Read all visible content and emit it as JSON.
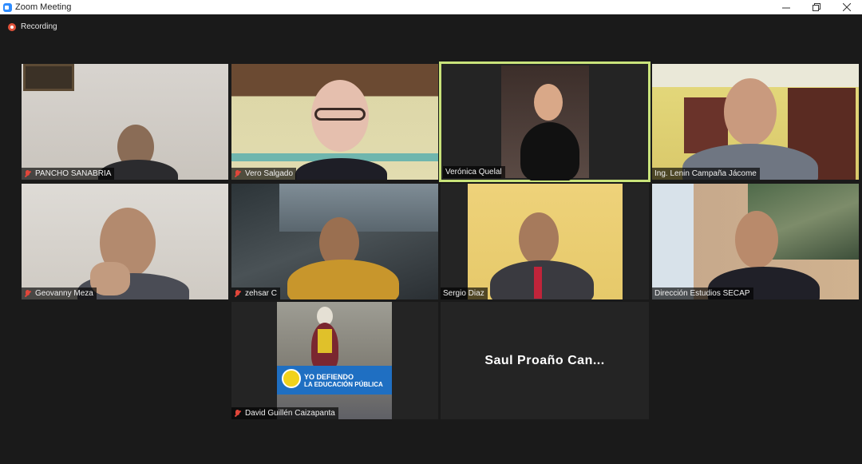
{
  "window": {
    "title": "Zoom Meeting"
  },
  "recording": {
    "label": "Recording"
  },
  "participants": [
    {
      "name": "PANCHO SANABRIA"
    },
    {
      "name": "Vero Salgado"
    },
    {
      "name": "Verónica Quelal"
    },
    {
      "name": "Ing. Lenin Campaña Jácome"
    },
    {
      "name": "Geovanny Meza"
    },
    {
      "name": "zehsar C"
    },
    {
      "name": "Sergio Diaz"
    },
    {
      "name": "Dirección Estudios SECAP"
    },
    {
      "name": "David Guillén Caizapanta"
    },
    {
      "name": "Saul Proaño Can..."
    }
  ],
  "poster": {
    "line1": "YO DEFIENDO",
    "line2": "LA EDUCACIÓN PÚBLICA"
  },
  "colors": {
    "active_speaker": "#c9e37a",
    "muted_mic": "#e0463a",
    "background": "#1a1a1a"
  }
}
